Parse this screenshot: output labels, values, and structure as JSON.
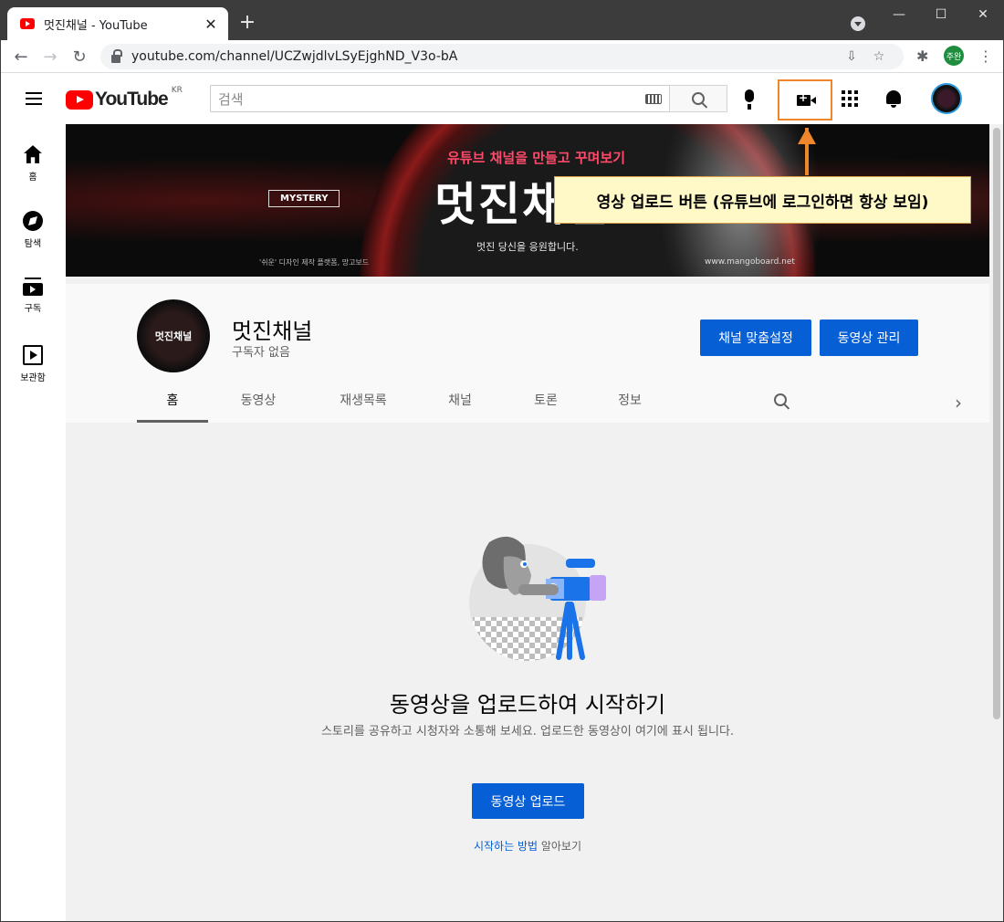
{
  "browser": {
    "tab_title": "멋진채널 - YouTube",
    "tab_close": "✕",
    "new_tab": "+",
    "url": "youtube.com/channel/UCZwjdlvLSyEjghND_V3o-bA",
    "profile_label": "주완",
    "window_controls": {
      "minimize": "—",
      "maximize": "☐",
      "close": "✕"
    },
    "nav": {
      "back": "←",
      "forward": "→",
      "reload": "↻"
    },
    "omnibox_actions": {
      "install": "⇩",
      "bookmark": "☆"
    },
    "extensions": {
      "puzzle": "✱",
      "menu": "⋮"
    }
  },
  "masthead": {
    "logo_text": "YouTube",
    "country": "KR",
    "search_placeholder": "검색"
  },
  "guide": {
    "items": [
      {
        "label": "홈",
        "icon": "home-icon"
      },
      {
        "label": "탐색",
        "icon": "compass-icon"
      },
      {
        "label": "구독",
        "icon": "subscriptions-icon"
      },
      {
        "label": "보관함",
        "icon": "library-icon"
      }
    ]
  },
  "banner": {
    "tagline_top": "유튜브 채널을 만들고 꾸며보기",
    "main_text": "멋진채널",
    "subtext": "멋진 당신을 응원합니다.",
    "badge": "MYSTERY",
    "credit": "'쉬운' 디자인 제작 플랫폼, 망고보드",
    "url": "www.mangoboard.net"
  },
  "channel": {
    "name": "멋진채널",
    "subscribers": "구독자 없음",
    "avatar_text": "멋진채널",
    "customize_button": "채널 맞춤설정",
    "manage_button": "동영상 관리",
    "tabs": [
      "홈",
      "동영상",
      "재생목록",
      "채널",
      "토론",
      "정보"
    ],
    "next_arrow": "›"
  },
  "empty_state": {
    "title": "동영상을 업로드하여 시작하기",
    "description": "스토리를 공유하고 시청자와 소통해 보세요. 업로드한 동영상이 여기에 표시 됩니다.",
    "upload_button": "동영상 업로드",
    "howto_link": "시작하는 방법",
    "howto_suffix": " 알아보기"
  },
  "annotation": {
    "callout": "영상 업로드 버튼 (유튜브에 로그인하면 항상 보임)",
    "color": "#f0862c"
  },
  "colors": {
    "brand_red": "#ff0000",
    "accent_blue": "#065fd4"
  }
}
